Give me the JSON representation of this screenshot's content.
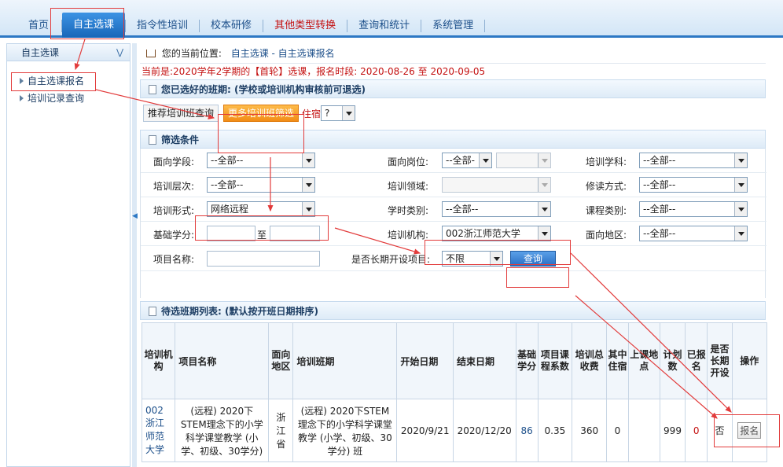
{
  "nav": {
    "items": [
      {
        "label": "首页",
        "color": "normal"
      },
      {
        "label": "自主选课",
        "color": "active"
      },
      {
        "label": "指令性培训",
        "color": "normal"
      },
      {
        "label": "校本研修",
        "color": "normal"
      },
      {
        "label": "其他类型转换",
        "color": "red"
      },
      {
        "label": "查询和统计",
        "color": "normal"
      },
      {
        "label": "系统管理",
        "color": "normal"
      }
    ]
  },
  "sidebar": {
    "header": "自主选课",
    "items": [
      {
        "label": "自主选课报名"
      },
      {
        "label": "培训记录查询"
      }
    ]
  },
  "breadcrumb": {
    "prefix": "您的当前位置:",
    "path": "自主选课 - 自主选课报名"
  },
  "notice": "当前是:2020学年2学期的【首轮】选课，报名时段: 2020-08-26 至 2020-09-05",
  "selected_section": "您已选好的班期: (学校或培训机构审核前可退选)",
  "tabs": {
    "recommend": "推荐培训班查询",
    "more": "更多培训班筛选",
    "lodging_label": "住宿",
    "lodging_value": "?"
  },
  "filter_section": "筛选条件",
  "filters": {
    "stage_label": "面向学段:",
    "stage_value": "--全部--",
    "post_label": "面向岗位:",
    "post_value": "--全部-",
    "subject_label": "培训学科:",
    "subject_value": "--全部--",
    "level_label": "培训层次:",
    "level_value": "--全部--",
    "field_label": "培训领域:",
    "mode_label": "修读方式:",
    "mode_value": "--全部--",
    "form_label": "培训形式:",
    "form_value": "网络远程",
    "hours_label": "学时类别:",
    "hours_value": "--全部--",
    "course_label": "课程类别:",
    "course_value": "--全部--",
    "credit_label": "基础学分:",
    "credit_to": "至",
    "org_label": "培训机构:",
    "org_value": "002浙江师范大学",
    "region_label": "面向地区:",
    "region_value": "--全部--",
    "name_label": "项目名称:",
    "longterm_label": "是否长期开设项目:",
    "longterm_value": "不限",
    "query_button": "查询"
  },
  "list_section": "待选班期列表: (默认按开班日期排序)",
  "table": {
    "headers": [
      "培训机构",
      "项目名称",
      "面向地区",
      "培训班期",
      "开始日期",
      "结束日期",
      "基础学分",
      "项目课程系数",
      "培训总收费",
      "其中住宿",
      "上课地点",
      "计划数",
      "已报名",
      "是否长期开设",
      "操作"
    ],
    "rows": [
      {
        "org_code": "002",
        "org_name": "浙江师范大学",
        "project": "(远程) 2020下STEM理念下的小学科学课堂教学 (小学、初级、30学分)",
        "region": "浙江省",
        "class_name": "(远程) 2020下STEM理念下的小学科学课堂教学 (小学、初级、30学分) 班",
        "start": "2020/9/21",
        "end": "2020/12/20",
        "credit": "86",
        "coef": "0.35",
        "fee": "360",
        "lodging": "0",
        "place": "",
        "plan": "999",
        "enrolled": "0",
        "longterm": "否",
        "action": "报名"
      }
    ]
  }
}
